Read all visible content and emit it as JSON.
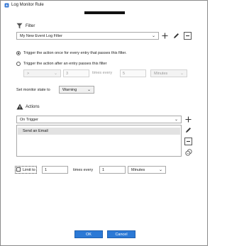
{
  "window": {
    "title": "Log Monitor Rule"
  },
  "filter": {
    "heading": "Filter",
    "selected": "My New Event Log Filter",
    "icons": [
      "funnel-icon",
      "plus-icon",
      "pencil-icon",
      "minus-icon"
    ]
  },
  "trigger": {
    "option_once": "Trigger the action once for every entry that passes this filter.",
    "option_after": "Trigger the action after an entry passes this filter",
    "selected_option": "once",
    "comparator": ">",
    "count": "3",
    "times_every_label": "times every",
    "interval": "5",
    "unit": "Minutes"
  },
  "monitor_state": {
    "label": "Set monitor state to",
    "value": "Warning"
  },
  "actions": {
    "heading": "Actions",
    "trigger_select": "On Trigger",
    "items": [
      "Send an Email"
    ]
  },
  "limit": {
    "checkbox_label": "Limit to",
    "checked": false,
    "count": "1",
    "times_every_label": "times every",
    "interval": "1",
    "unit": "Minutes"
  },
  "buttons": {
    "ok": "OK",
    "cancel": "Cancel"
  }
}
